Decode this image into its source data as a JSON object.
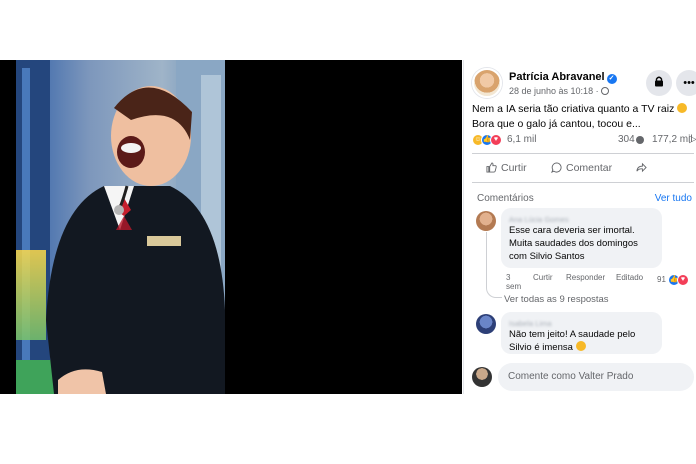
{
  "post": {
    "author": "Patrícia Abravanel",
    "date": "28 de junho às 10:18 ·",
    "caption_line1": "Nem a IA seria tão criativa quanto a TV raiz",
    "caption_line2": "Bora que o galo já cantou, tocou e..."
  },
  "stats": {
    "reactions": "6,1 mil",
    "comments": "304",
    "views": "177,2 mil"
  },
  "actions": {
    "like": "Curtir",
    "comment": "Comentar"
  },
  "comments_section": {
    "title": "Comentários",
    "see_all": "Ver tudo"
  },
  "comments": [
    {
      "name": "Ana Lúcia Gomes",
      "text_line1": "Esse cara deveria ser imortal.",
      "text_line2": "Muita saudades dos domingos",
      "text_line3": "com Silvio Santos",
      "time_1": "3",
      "time_2": "sem",
      "like": "Curtir",
      "reply": "Responder",
      "edited": "Editado",
      "reactions": "91"
    },
    {
      "name": "Isabela Lima",
      "text_line1": "Não tem jeito! A saudade pelo",
      "text_line2": "Silvio é imensa"
    }
  ],
  "replies_link": "Ver todas as 9 respostas",
  "composer": {
    "placeholder": "Comente como Valter Prado"
  },
  "colors": {
    "brand_blue": "#1877f2",
    "bubble": "#f0f2f5",
    "secondary_text": "#65676b"
  },
  "icons": [
    "verified-icon",
    "globe-icon",
    "lock-icon",
    "more-icon",
    "like-icon",
    "comment-icon",
    "share-icon",
    "reply-arrow-icon"
  ]
}
